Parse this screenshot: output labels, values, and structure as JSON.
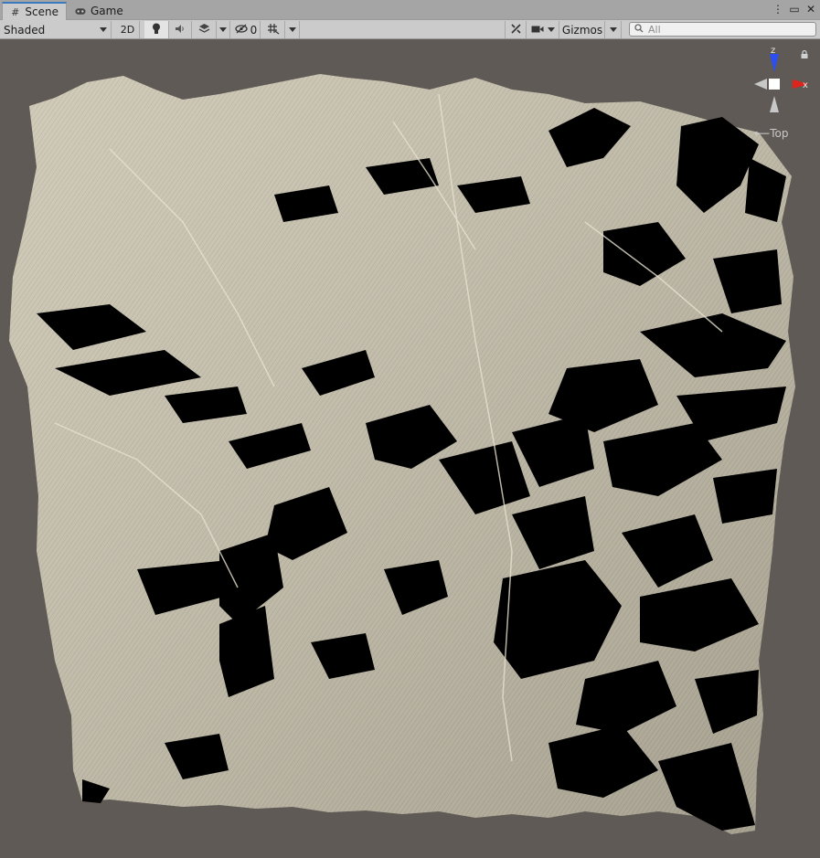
{
  "tabs": [
    {
      "label": "Scene",
      "icon": "grid-icon",
      "active": true
    },
    {
      "label": "Game",
      "icon": "gamepad-icon",
      "active": false
    }
  ],
  "window_controls": [
    "more-icon",
    "maximize-icon",
    "close-icon"
  ],
  "toolbar": {
    "draw_mode": "Shaded",
    "toggle_2d": "2D",
    "hidden_count": "0",
    "gizmos": "Gizmos",
    "search_placeholder": "All"
  },
  "scene_gizmo": {
    "view_label": "Top",
    "axis_z": "z",
    "axis_x": "x",
    "colors": {
      "z": "#2b4ff0",
      "x": "#e0241c",
      "neutral": "#c8c8c8"
    }
  },
  "terrain": {
    "color_light": "#cbc4b0",
    "color_shadow": "#000000"
  }
}
